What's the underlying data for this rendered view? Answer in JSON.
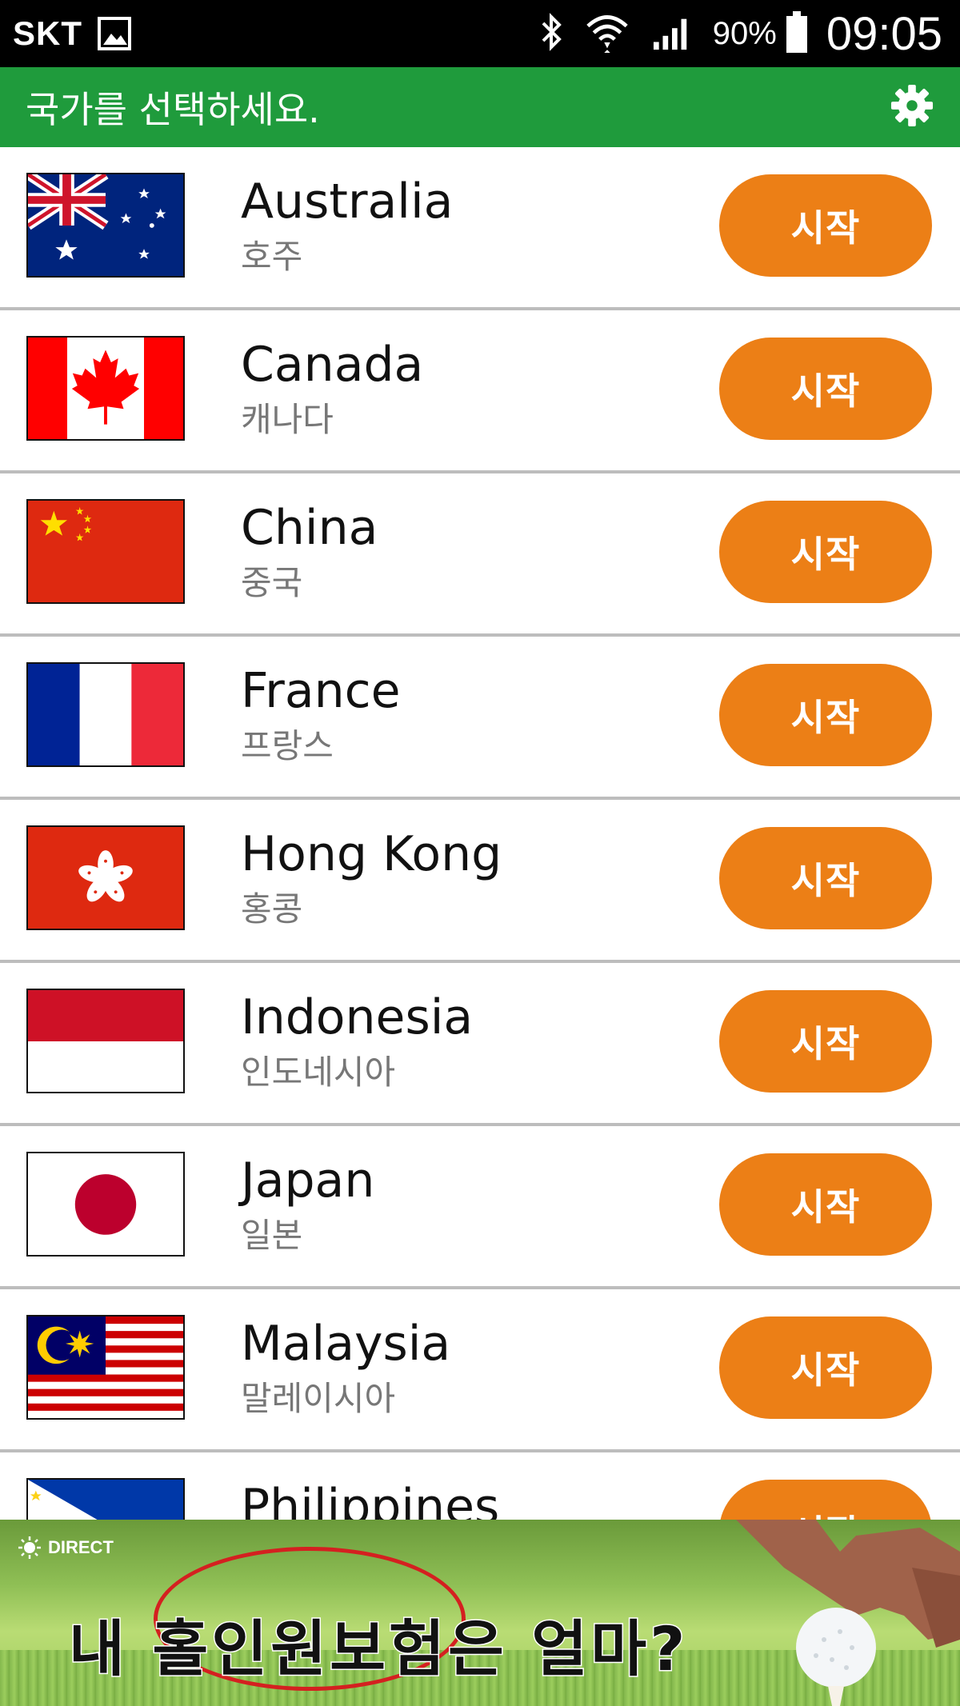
{
  "status_bar": {
    "carrier": "SKT",
    "battery": "90%",
    "time": "09:05"
  },
  "header": {
    "title": "국가를 선택하세요."
  },
  "countries": [
    {
      "name": "Australia",
      "korean": "호주",
      "button": "시작"
    },
    {
      "name": "Canada",
      "korean": "캐나다",
      "button": "시작"
    },
    {
      "name": "China",
      "korean": "중국",
      "button": "시작"
    },
    {
      "name": "France",
      "korean": "프랑스",
      "button": "시작"
    },
    {
      "name": "Hong Kong",
      "korean": "홍콩",
      "button": "시작"
    },
    {
      "name": "Indonesia",
      "korean": "인도네시아",
      "button": "시작"
    },
    {
      "name": "Japan",
      "korean": "일본",
      "button": "시작"
    },
    {
      "name": "Malaysia",
      "korean": "말레이시아",
      "button": "시작"
    },
    {
      "name": "Philippines",
      "korean": "",
      "button": "시작"
    }
  ],
  "ad": {
    "brand": "DIRECT",
    "text": "내 홀인원보험은 얼마?"
  },
  "colors": {
    "header_green": "#1f9b3c",
    "button_orange": "#ec7f16",
    "divider": "#bdbdbd"
  },
  "icons": [
    "gallery-icon",
    "bluetooth-icon",
    "wifi-icon",
    "signal-icon",
    "battery-icon",
    "gear-icon"
  ]
}
